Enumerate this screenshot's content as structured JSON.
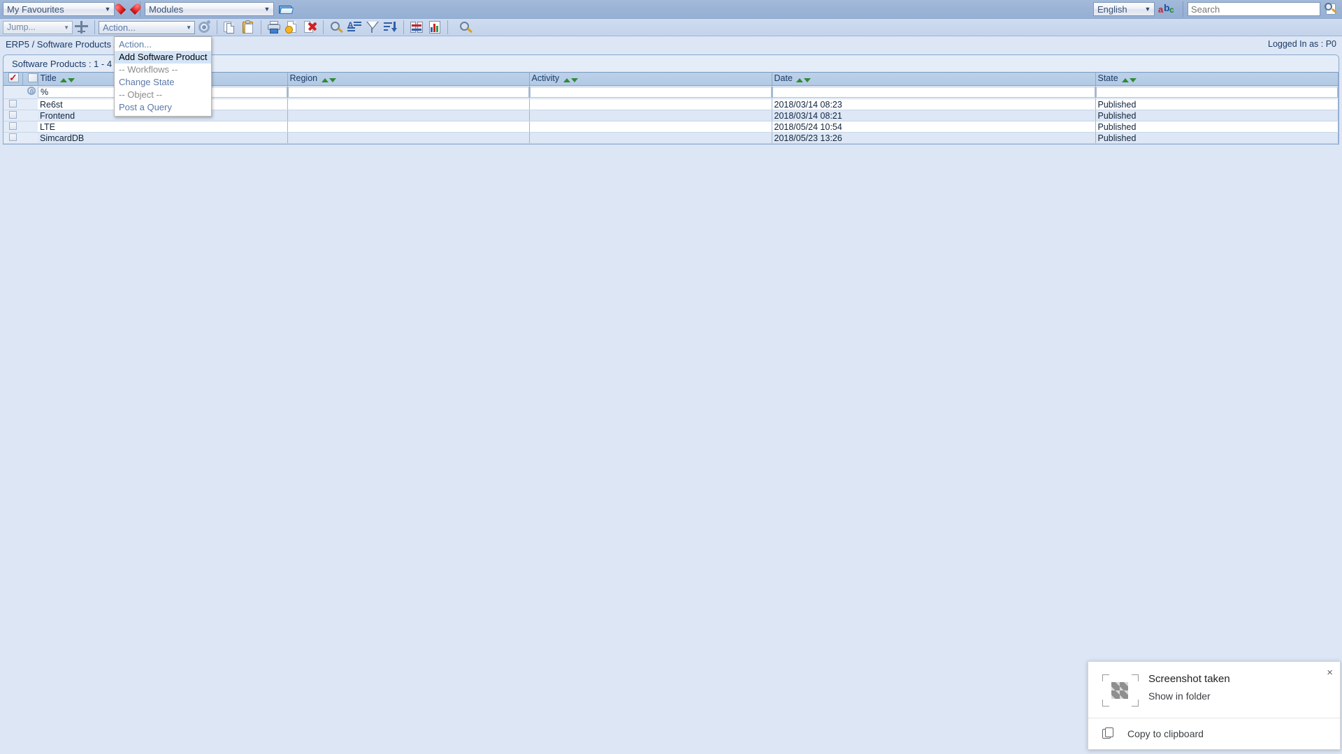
{
  "topbar": {
    "favourites_label": "My Favourites",
    "modules_label": "Modules",
    "language_label": "English",
    "search_placeholder": "Search",
    "search_value": ""
  },
  "toolbar": {
    "jump_label": "Jump...",
    "action_label": "Action..."
  },
  "action_menu": {
    "items": [
      {
        "label": "Action...",
        "kind": "normal"
      },
      {
        "label": "Add Software Product",
        "kind": "selected"
      },
      {
        "label": "-- Workflows --",
        "kind": "group"
      },
      {
        "label": "Change State",
        "kind": "normal"
      },
      {
        "label": "-- Object --",
        "kind": "group"
      },
      {
        "label": "Post a Query",
        "kind": "normal"
      }
    ]
  },
  "breadcrumb": {
    "text": "ERP5 / Software Products /",
    "logged_in": "Logged In as : P0"
  },
  "listing": {
    "title": "Software Products : 1 - 4 of 4 records selected",
    "columns": [
      "Title",
      "Region",
      "Activity",
      "Date",
      "State"
    ],
    "filters": {
      "title": "%",
      "region": "",
      "activity": "",
      "date": "",
      "state": ""
    },
    "rows": [
      {
        "title": "Re6st",
        "region": "",
        "activity": "",
        "date": "2018/03/14   08:23",
        "state": "Published"
      },
      {
        "title": "Frontend",
        "region": "",
        "activity": "",
        "date": "2018/03/14   08:21",
        "state": "Published"
      },
      {
        "title": "LTE",
        "region": "",
        "activity": "",
        "date": "2018/05/24   10:54",
        "state": "Published"
      },
      {
        "title": "SimcardDB",
        "region": "",
        "activity": "",
        "date": "2018/05/23   13:26",
        "state": "Published"
      }
    ]
  },
  "notification": {
    "title": "Screenshot taken",
    "link": "Show in folder",
    "footer": "Copy to clipboard",
    "close": "×"
  },
  "colors": {
    "accent": "#2f5fa8",
    "header_bg": "#b2c9e4",
    "page_bg": "#dce6f5",
    "sort_green": "#2f8a36",
    "highlight": "#d3e4f7"
  }
}
